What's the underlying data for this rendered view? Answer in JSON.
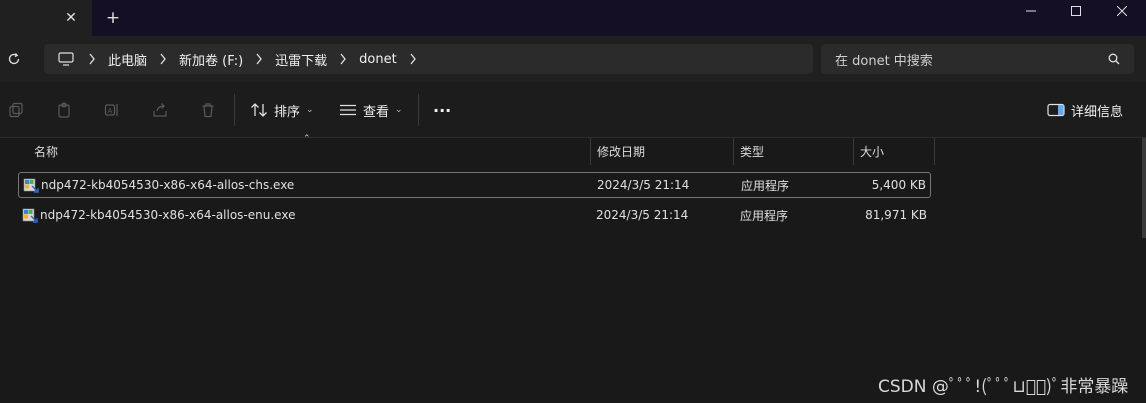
{
  "window": {
    "tab_close": "✕",
    "new_tab": "+",
    "minimize": "—",
    "maximize": "☐",
    "close": "✕"
  },
  "breadcrumbs": [
    "此电脑",
    "新加卷 (F:)",
    "迅雷下载",
    "donet"
  ],
  "search": {
    "placeholder": "在 donet 中搜索"
  },
  "toolbar": {
    "sort_label": "排序",
    "view_label": "查看",
    "more_label": "···",
    "details_label": "详细信息"
  },
  "columns": {
    "name": "名称",
    "modified": "修改日期",
    "type": "类型",
    "size": "大小"
  },
  "files": [
    {
      "name": "ndp472-kb4054530-x86-x64-allos-chs.exe",
      "modified": "2024/3/5 21:14",
      "type": "应用程序",
      "size": "5,400 KB",
      "selected": true
    },
    {
      "name": "ndp472-kb4054530-x86-x64-allos-enu.exe",
      "modified": "2024/3/5 21:14",
      "type": "应用程序",
      "size": "81,971 KB",
      "selected": false
    }
  ],
  "watermark": "CSDN @ﾟﾟﾟ!(ﾟﾟﾟ⊔ﾟﾟ)ﾟ非常暴躁"
}
